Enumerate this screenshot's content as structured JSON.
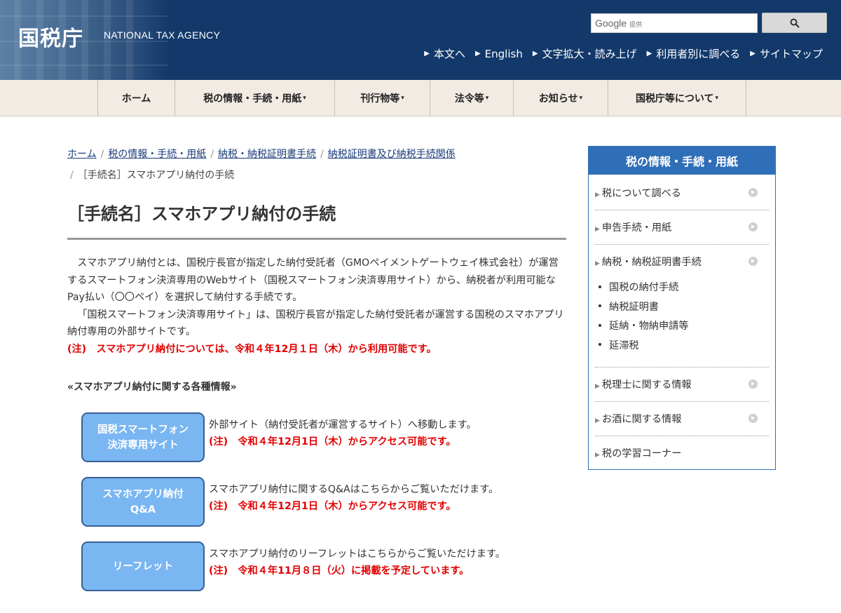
{
  "header": {
    "logo": "国税庁",
    "logo_en": "NATIONAL TAX AGENCY",
    "search": {
      "brand": "Google",
      "brand_suffix": "提供"
    },
    "util_links": [
      "本文へ",
      "English",
      "文字拡大・読み上げ",
      "利用者別に調べる",
      "サイトマップ"
    ]
  },
  "nav": {
    "items": [
      {
        "label": "ホーム",
        "caret": ""
      },
      {
        "label": "税の情報・手続・用紙",
        "caret": "▾"
      },
      {
        "label": "刊行物等",
        "caret": "▾"
      },
      {
        "label": "法令等",
        "caret": "▾"
      },
      {
        "label": "お知らせ",
        "caret": "▾"
      },
      {
        "label": "国税庁等について",
        "caret": "▾"
      }
    ]
  },
  "breadcrumb": {
    "links": [
      "ホーム",
      "税の情報・手続・用紙",
      "納税・納税証明書手続",
      "納税証明書及び納税手続関係"
    ],
    "current": "［手続名］スマホアプリ納付の手続"
  },
  "main": {
    "title": "［手続名］スマホアプリ納付の手続",
    "para1": "スマホアプリ納付とは、国税庁長官が指定した納付受託者（GMOペイメントゲートウェイ株式会社）が運営するスマートフォン決済専用のWebサイト（国税スマートフォン決済専用サイト）から、納税者が利用可能なPay払い（〇〇ペイ）を選択して納付する手続です。",
    "para2": "「国税スマートフォン決済専用サイト」は、国税庁長官が指定した納付受託者が運営する国税のスマホアプリ納付専用の外部サイトです。",
    "note": "(注)　スマホアプリ納付については、令和４年12月１日（木）から利用可能です。",
    "sub_heading": "«スマホアプリ納付に関する各種情報»",
    "links": [
      {
        "button_line1": "国税スマートフォン",
        "button_line2": "決済専用サイト",
        "text": "外部サイト（納付受託者が運営するサイト）へ移動します。",
        "note": "(注)　令和４年12月1日（木）からアクセス可能です。"
      },
      {
        "button_line1": "スマホアプリ納付",
        "button_line2": "Q&A",
        "text": "スマホアプリ納付に関するQ&Aはこちらからご覧いただけます。",
        "note": "(注)　令和４年12月1日（木）からアクセス可能です。"
      },
      {
        "button_line1": "リーフレット",
        "button_line2": "",
        "text": "スマホアプリ納付のリーフレットはこちらからご覧いただけます。",
        "note": "(注)　令和４年11月８日（火）に掲載を予定しています。"
      }
    ]
  },
  "sidebar": {
    "title": "税の情報・手続・用紙",
    "items": [
      "税について調べる",
      "申告手続・用紙",
      "納税・納税証明書手続",
      "税理士に関する情報",
      "お酒に関する情報",
      "税の学習コーナー"
    ],
    "sub_items": [
      "国税の納付手続",
      "納税証明書",
      "延納・物納申請等",
      "延滞税"
    ]
  },
  "colors": {
    "header_bg": "#13396b",
    "nav_bg": "#f1ebe4",
    "accent": "#2f6fb7",
    "note_red": "#e30000",
    "button_blue": "#79b6f2"
  }
}
